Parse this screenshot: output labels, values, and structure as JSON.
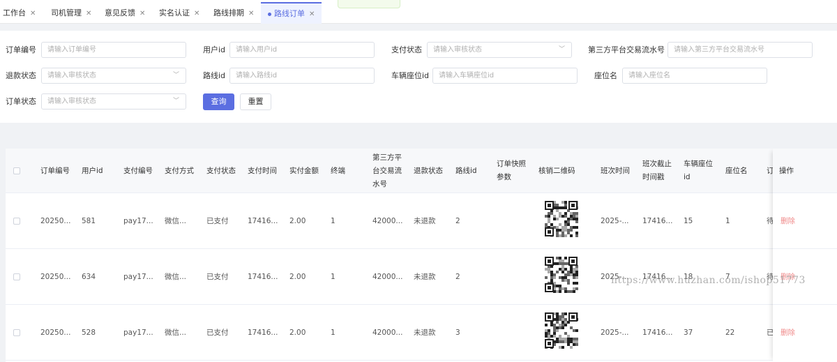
{
  "tabs": [
    {
      "label": "工作台",
      "closable": true
    },
    {
      "label": "司机管理",
      "closable": true
    },
    {
      "label": "意见反馈",
      "closable": true
    },
    {
      "label": "实名认证",
      "closable": true
    },
    {
      "label": "路线排期",
      "closable": true
    },
    {
      "label": "路线订单",
      "closable": true,
      "active": true
    }
  ],
  "close_glyph": "✕",
  "filters": {
    "order_no": {
      "label": "订单编号",
      "placeholder": "请输入订单编号"
    },
    "user_id": {
      "label": "用户id",
      "placeholder": "请输入用户id"
    },
    "pay_status": {
      "label": "支付状态",
      "placeholder": "请输入审核状态"
    },
    "third_party_no": {
      "label": "第三方平台交易流水号",
      "placeholder": "请输入第三方平台交易流水号"
    },
    "refund_status": {
      "label": "退款状态",
      "placeholder": "请输入审核状态"
    },
    "route_id": {
      "label": "路线id",
      "placeholder": "请输入路线id"
    },
    "seat_id": {
      "label": "车辆座位id",
      "placeholder": "请输入车辆座位id"
    },
    "seat_name": {
      "label": "座位名",
      "placeholder": "请输入座位名"
    },
    "order_status": {
      "label": "订单状态",
      "placeholder": "请输入审核状态"
    },
    "query_label": "查询",
    "reset_label": "重置"
  },
  "table": {
    "headers": {
      "order_no": "订单编号",
      "user_id": "用户id",
      "pay_no": "支付编号",
      "pay_method": "支付方式",
      "pay_status": "支付状态",
      "pay_time": "支付时间",
      "amount": "实付金额",
      "terminal": "终端",
      "third_no": [
        "第三方平",
        "台交易流",
        "水号"
      ],
      "refund_status": "退款状态",
      "route_id": "路线id",
      "snapshot": [
        "订单快照",
        "参数"
      ],
      "qr": "核销二维码",
      "shift_time": "班次时间",
      "shift_deadline": [
        "班次截止",
        "时间戳"
      ],
      "seat_id": [
        "车辆座位",
        "id"
      ],
      "seat_name": "座位名",
      "status_partial": "订",
      "actions": "操作"
    },
    "rows": [
      {
        "order_no": "20250...",
        "user_id": "581",
        "pay_no": "pay17...",
        "pay_method": "微信...",
        "pay_status": "已支付",
        "pay_time": "17416...",
        "amount": "2.00",
        "terminal": "1",
        "third_no": "42000...",
        "refund_status": "未退款",
        "route_id": "2",
        "shift_time": "2025-...",
        "shift_deadline": "17416...",
        "seat_id": "15",
        "seat_name": "1",
        "status_partial": "待",
        "action": "删除"
      },
      {
        "order_no": "20250...",
        "user_id": "634",
        "pay_no": "pay17...",
        "pay_method": "微信...",
        "pay_status": "已支付",
        "pay_time": "17416...",
        "amount": "2.00",
        "terminal": "1",
        "third_no": "42000...",
        "refund_status": "未退款",
        "route_id": "2",
        "shift_time": "2025-...",
        "shift_deadline": "17416...",
        "seat_id": "18",
        "seat_name": "7",
        "status_partial": "待",
        "action": "删除"
      },
      {
        "order_no": "20250...",
        "user_id": "528",
        "pay_no": "pay17...",
        "pay_method": "微信...",
        "pay_status": "已支付",
        "pay_time": "17416...",
        "amount": "2.00",
        "terminal": "1",
        "third_no": "42000...",
        "refund_status": "未退款",
        "route_id": "3",
        "shift_time": "2025-...",
        "shift_deadline": "17416...",
        "seat_id": "37",
        "seat_name": "22",
        "status_partial": "已",
        "action": "删除"
      }
    ]
  },
  "watermark": "https://www.huzhan.com/ishop51773",
  "colors": {
    "primary": "#5b6ee1",
    "danger": "#f08b8b"
  }
}
